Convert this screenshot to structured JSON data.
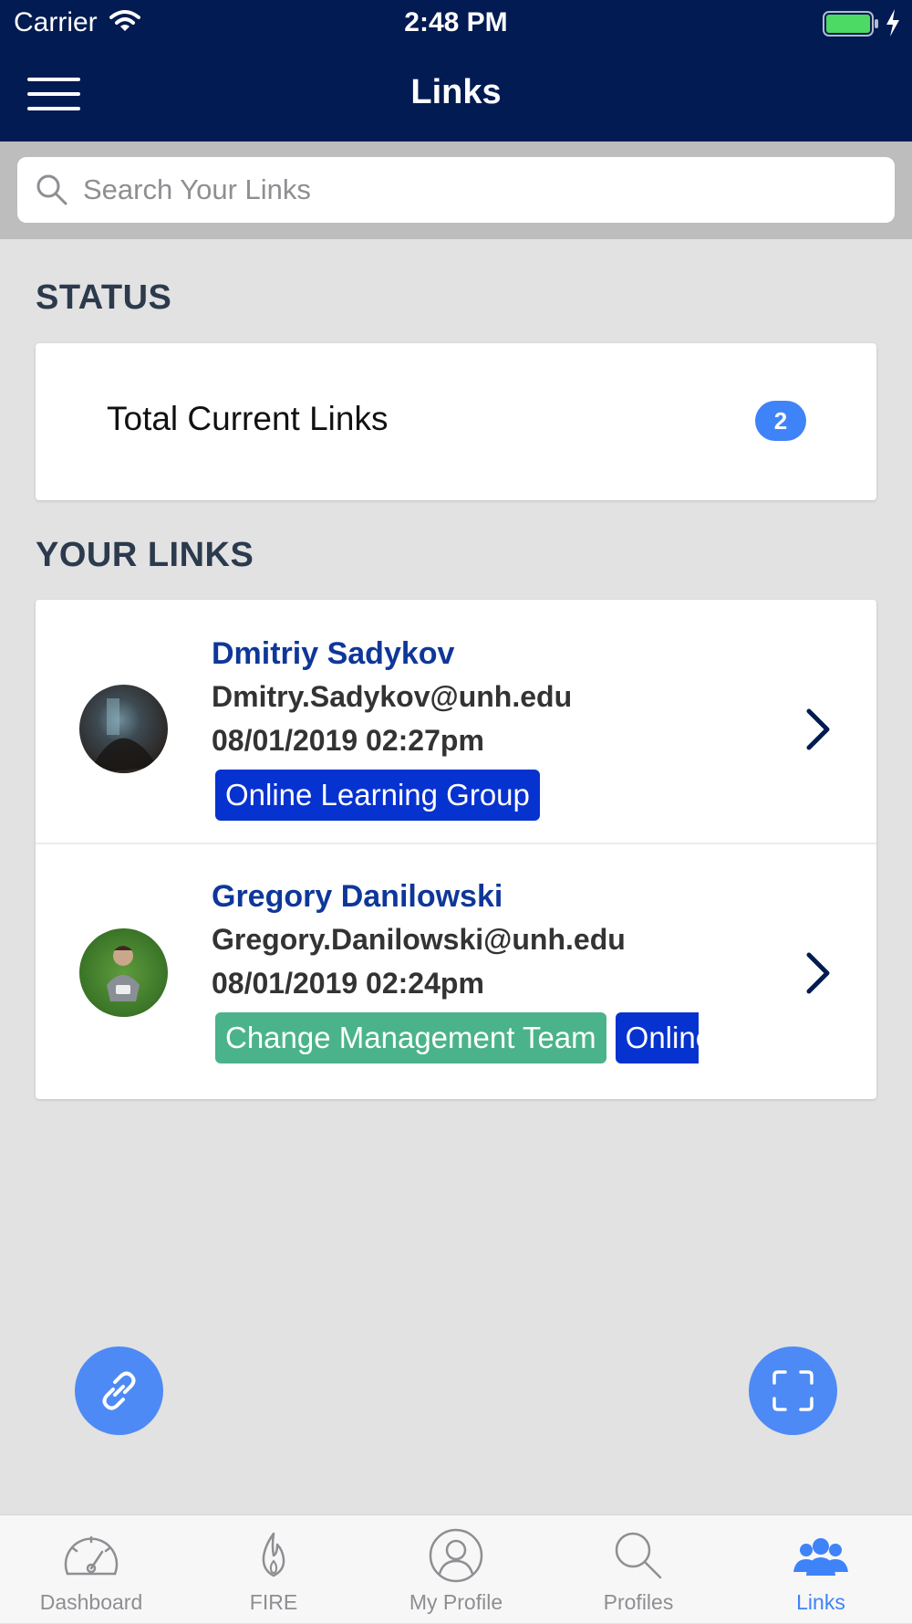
{
  "status_bar": {
    "carrier": "Carrier",
    "time": "2:48 PM"
  },
  "nav": {
    "title": "Links"
  },
  "search": {
    "placeholder": "Search Your Links"
  },
  "status_section": {
    "title": "STATUS",
    "total_label": "Total Current Links",
    "total_count": "2"
  },
  "links_section": {
    "title": "YOUR LINKS",
    "links": [
      {
        "name": "Dmitriy Sadykov",
        "email": "Dmitry.Sadykov@unh.edu",
        "date": "08/01/2019 02:27pm",
        "tags": [
          {
            "label": "Online Learning Group",
            "color": "#0632cf"
          }
        ]
      },
      {
        "name": "Gregory Danilowski",
        "email": "Gregory.Danilowski@unh.edu",
        "date": "08/01/2019 02:24pm",
        "tags": [
          {
            "label": "Change Management Team",
            "color": "#4bb38b"
          },
          {
            "label": "Online Learning Group",
            "color": "#0632cf"
          }
        ]
      }
    ]
  },
  "fabs": {
    "left_icon": "link-icon",
    "right_icon": "scan-icon",
    "color": "#4d8af5"
  },
  "tabbar": {
    "tabs": [
      {
        "label": "Dashboard",
        "icon": "speedometer-icon"
      },
      {
        "label": "FIRE",
        "icon": "flame-icon"
      },
      {
        "label": "My Profile",
        "icon": "person-icon"
      },
      {
        "label": "Profiles",
        "icon": "search-icon"
      },
      {
        "label": "Links",
        "icon": "people-icon"
      }
    ],
    "active": "Links",
    "active_color": "#3f83f8"
  },
  "colors": {
    "header": "#021b52",
    "name": "#0e3799",
    "badge": "#3f83f8"
  }
}
